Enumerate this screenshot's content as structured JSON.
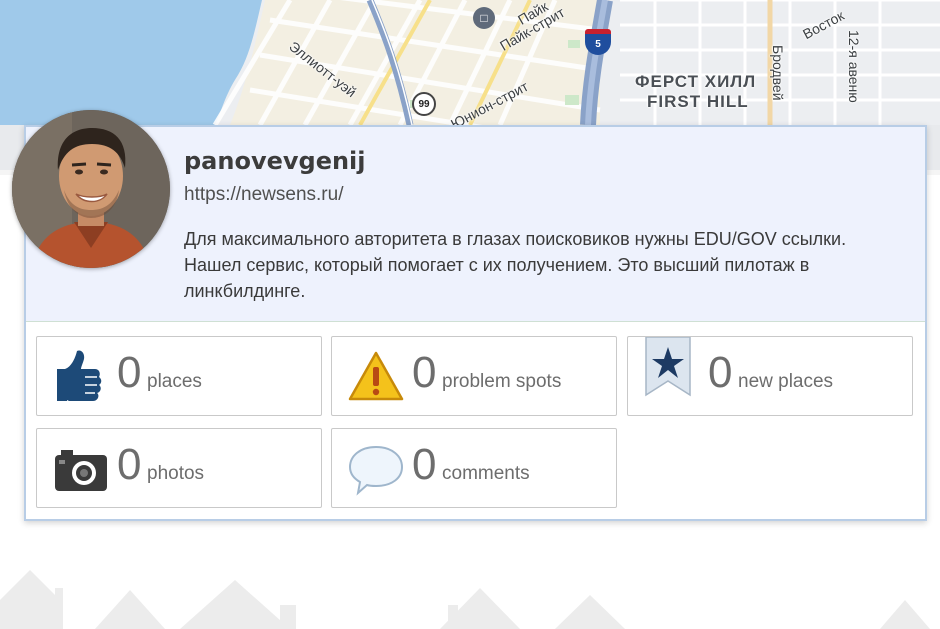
{
  "map": {
    "labels": {
      "elliott_way": "Эллиотт-уэй",
      "pike_street": "Пайк-стрит",
      "pike_short": "Пайк",
      "union_street": "Юнион-стрит",
      "first_hill_ru": "ФЕРСТ ХИЛЛ",
      "first_hill_en": "FIRST HILL",
      "broadway": "Бродвей",
      "vostok": "Восток",
      "twelfth_ave": "12-я авеню"
    },
    "shields": {
      "state_route": "99",
      "interstate": "5"
    },
    "icons": {
      "transit": "bus-stop-icon"
    }
  },
  "profile": {
    "username": "panovevgenij",
    "website": "https://newsens.ru/",
    "bio": "Для максимального авторитета в глазах поисковиков нужны EDU/GOV ссылки. Нашел сервис, который помогает с их получением. Это высший пилотаж в линкбилдинге."
  },
  "stats": [
    {
      "count": "0",
      "label": "places",
      "icon": "thumbs-up-icon"
    },
    {
      "count": "0",
      "label": "problem spots",
      "icon": "warning-icon"
    },
    {
      "count": "0",
      "label": "new places",
      "icon": "star-bookmark-icon"
    },
    {
      "count": "0",
      "label": "photos",
      "icon": "camera-icon"
    },
    {
      "count": "0",
      "label": "comments",
      "icon": "speech-bubble-icon"
    }
  ],
  "colors": {
    "card_border": "#b8cde6",
    "header_bg": "#eef2fd",
    "water": "#9fc9ea",
    "stat_text": "#6d6d6d",
    "icon_blue": "#1d4a78",
    "warning_yellow": "#f4c21b"
  }
}
